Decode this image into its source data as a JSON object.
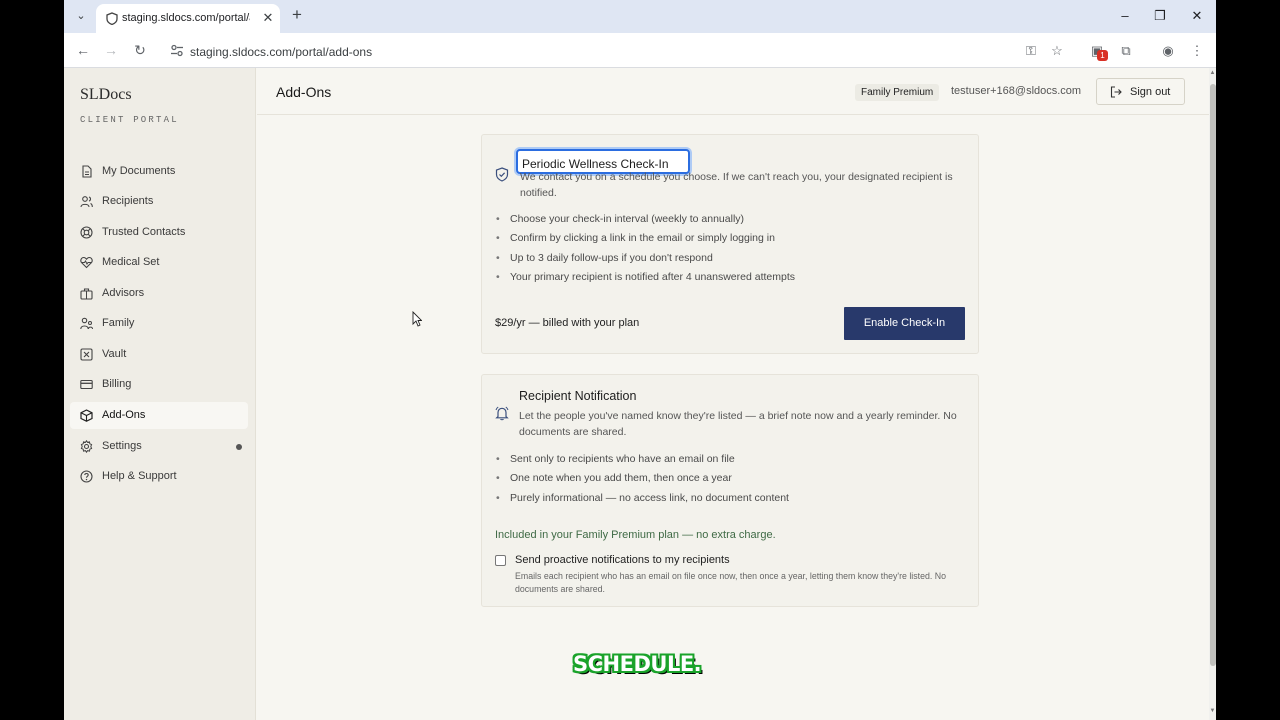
{
  "browser": {
    "tab_title": "staging.sldocs.com/portal/add",
    "url": "staging.sldocs.com/portal/add-ons",
    "extension_badge": "1"
  },
  "sidebar": {
    "brand": "SLDocs",
    "brand_sub": "CLIENT PORTAL",
    "items": [
      {
        "label": "My Documents",
        "icon": "document-icon"
      },
      {
        "label": "Recipients",
        "icon": "users-icon"
      },
      {
        "label": "Trusted Contacts",
        "icon": "lifebuoy-icon"
      },
      {
        "label": "Medical Set",
        "icon": "heart-pulse-icon"
      },
      {
        "label": "Advisors",
        "icon": "briefcase-icon"
      },
      {
        "label": "Family",
        "icon": "family-icon"
      },
      {
        "label": "Vault",
        "icon": "vault-icon"
      },
      {
        "label": "Billing",
        "icon": "credit-card-icon"
      },
      {
        "label": "Add-Ons",
        "icon": "box-icon",
        "active": true
      },
      {
        "label": "Settings",
        "icon": "gear-icon"
      },
      {
        "label": "Help & Support",
        "icon": "help-icon"
      }
    ]
  },
  "header": {
    "title": "Add-Ons",
    "plan_badge": "Family Premium",
    "email": "testuser+168@sldocs.com",
    "signout_label": "Sign out"
  },
  "checkin": {
    "title": "Periodic Wellness Check-In",
    "description": "We contact you on a schedule you choose. If we can't reach you, your designated recipient is notified.",
    "features": [
      "Choose your check-in interval (weekly to annually)",
      "Confirm by clicking a link in the email or simply logging in",
      "Up to 3 daily follow-ups if you don't respond",
      "Your primary recipient is notified after 4 unanswered attempts"
    ],
    "price": "$29/yr — billed with your plan",
    "button_label": "Enable Check-In"
  },
  "notification": {
    "title": "Recipient Notification",
    "description": "Let the people you've named know they're listed — a brief note now and a yearly reminder. No documents are shared.",
    "features": [
      "Sent only to recipients who have an email on file",
      "One note when you add them, then once a year",
      "Purely informational — no access link, no document content"
    ],
    "included_note": "Included in your Family Premium plan — no extra charge.",
    "checkbox_label": "Send proactive notifications to my recipients",
    "checkbox_help": "Emails each recipient who has an email on file once now, then once a year, letting them know they're listed. No documents are shared.",
    "checkbox_checked": false
  },
  "caption": "SCHEDULE."
}
